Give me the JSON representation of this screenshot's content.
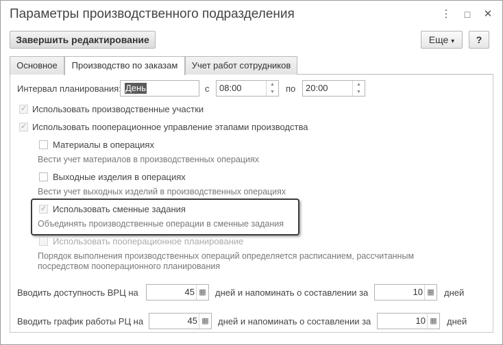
{
  "window": {
    "title": "Параметры производственного подразделения",
    "more_icon": "⋮",
    "minimize_icon": "□",
    "close_icon": "✕"
  },
  "toolbar": {
    "finish_label": "Завершить редактирование",
    "more_label": "Еще",
    "more_arrow": "▾",
    "help_label": "?"
  },
  "tabs": [
    {
      "label": "Основное",
      "active": false
    },
    {
      "label": "Производство по заказам",
      "active": true
    },
    {
      "label": "Учет работ сотрудников",
      "active": false
    }
  ],
  "planning": {
    "interval_label": "Интервал планирования:",
    "interval_value": "День",
    "from_label": "с",
    "from_value": "08:00",
    "to_label": "по",
    "to_value": "20:00"
  },
  "options": {
    "use_sections": {
      "label": "Использовать производственные участки",
      "checked": true
    },
    "use_operations": {
      "label": "Использовать пооперационное управление этапами производства",
      "checked": true
    },
    "materials": {
      "label": "Материалы в операциях",
      "checked": false,
      "note": "Вести учет материалов в производственных операциях"
    },
    "outputs": {
      "label": "Выходные изделия в операциях",
      "checked": false,
      "note": "Вести учет выходных изделий в производственных операциях"
    },
    "shift_tasks": {
      "label": "Использовать сменные задания",
      "checked": true,
      "note": "Объединять производственные операции в сменные задания"
    },
    "op_planning": {
      "label": "Использовать пооперационное планирование",
      "checked": false,
      "note_line1": "Порядок выполнения производственных операций определяется расписанием, рассчитанным",
      "note_line2": "посредством пооперационного планирования"
    }
  },
  "availability": {
    "label": "Вводить доступность ВРЦ на",
    "days_value": "45",
    "remind_label": "дней и напоминать о составлении за",
    "remind_value": "10",
    "days_label": "дней"
  },
  "schedule": {
    "label": "Вводить график работы РЦ на",
    "days_value": "45",
    "remind_label": "дней и напоминать о составлении за",
    "remind_value": "10",
    "days_label": "дней"
  }
}
